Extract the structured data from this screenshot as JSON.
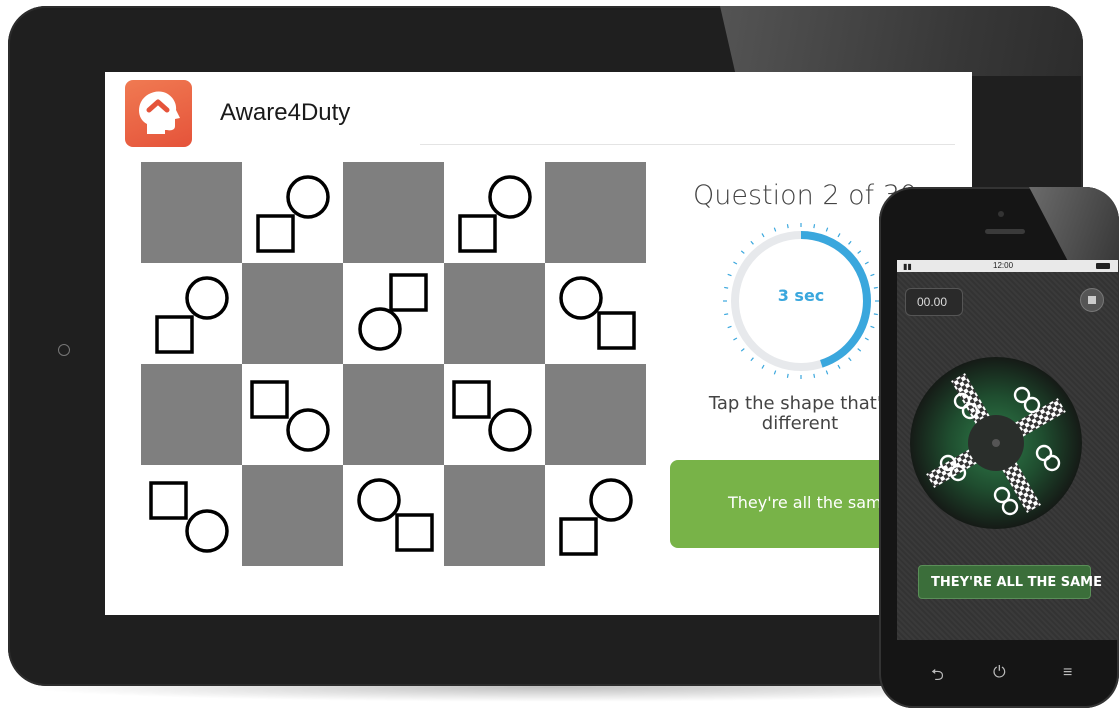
{
  "app": {
    "title": "Aware4Duty",
    "logo_icon": "head-chevron-icon",
    "accent_color": "#e95c3e"
  },
  "quiz": {
    "question_label": "Question 2 of 30",
    "timer_label": "3 sec",
    "timer_progress": 0.45,
    "instruction": "Tap the shape that's different",
    "button_label": "They're all the same!",
    "button_color": "#78b348",
    "timer_color": "#3aa7dd"
  },
  "grid": {
    "rows": 4,
    "cols": 5,
    "cells": [
      [
        "gray",
        "sq-bl",
        "gray",
        "sq-bl",
        "gray"
      ],
      [
        "sq-bl",
        "gray",
        "circ-bl",
        "gray",
        "circ-tl"
      ],
      [
        "gray",
        "sq-tl",
        "gray",
        "sq-tl",
        "gray"
      ],
      [
        "sq-tl",
        "gray",
        "circ-tl",
        "gray",
        "sq-bl"
      ]
    ]
  },
  "phone": {
    "status_time": "12:00",
    "timer_value": "00.00",
    "button_label": "THEY'RE ALL THE SAME",
    "stop_icon": "stop-icon",
    "nav_icons": [
      "back-icon",
      "power-icon",
      "menu-icon"
    ],
    "nav_glyphs": [
      "⮌",
      "⏻",
      "≡"
    ]
  }
}
